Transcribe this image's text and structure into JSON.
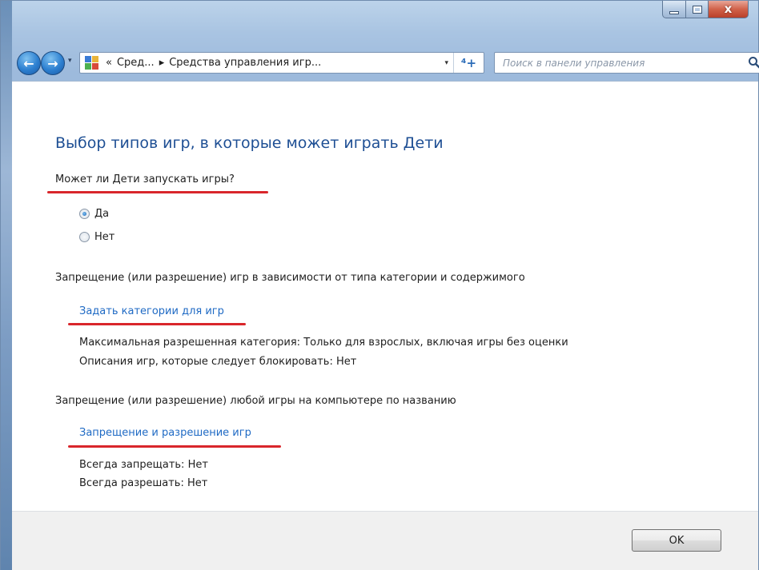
{
  "address_bar": {
    "overflow_chevron": "«",
    "crumbs": [
      "Сред...",
      "Средства управления игр..."
    ],
    "separator": "▸",
    "dropdown_glyph": "▾",
    "refresh_glyph": "⁴+",
    "icon": "control-panel-icon"
  },
  "search": {
    "placeholder": "Поиск в панели управления",
    "icon": "search-icon"
  },
  "navigation": {
    "back_icon": "arrow-left-icon",
    "forward_icon": "arrow-right-icon",
    "back_glyph": "←",
    "forward_glyph": "→",
    "recent_dropdown_glyph": "▾"
  },
  "window_controls": {
    "close_glyph": "x"
  },
  "content": {
    "heading": "Выбор типов игр, в которые может играть Дети",
    "question": "Может ли Дети запускать игры?",
    "radio_options": [
      {
        "label": "Да",
        "checked": true
      },
      {
        "label": "Нет",
        "checked": false
      }
    ],
    "category_section": {
      "label": "Запрещение (или разрешение) игр в зависимости от типа категории и содержимого",
      "link": "Задать категории для игр",
      "max_category": "Максимальная разрешенная категория:  Только для взрослых, включая игры без оценки",
      "descriptors": "Описания игр, которые следует блокировать:  Нет"
    },
    "title_section": {
      "label": "Запрещение (или разрешение) любой игры на компьютере по названию",
      "link": "Запрещение и разрешение игр",
      "always_block": "Всегда запрещать:  Нет",
      "always_allow": "Всегда разрешать:  Нет"
    }
  },
  "footer": {
    "ok_label": "OK"
  },
  "colors": {
    "heading": "#1e4f94",
    "link": "#1f6ac4",
    "annotation_underline": "#d9262b",
    "footer_bg": "#f0f0f0"
  }
}
